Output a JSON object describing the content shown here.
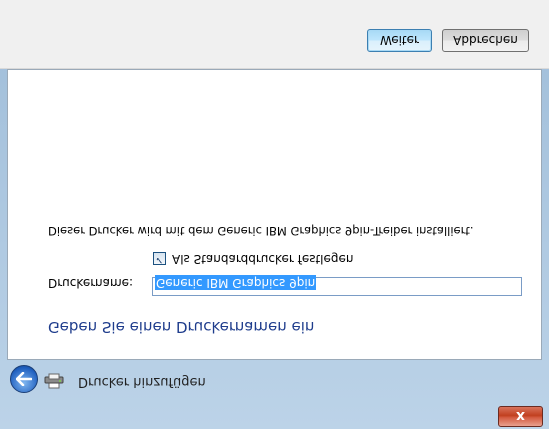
{
  "titlebar": {
    "close_label": "x"
  },
  "header": {
    "title": "Drucker hinzufügen"
  },
  "main": {
    "heading": "Geben Sie einen Druckernamen ein",
    "name_label": "Druckername:",
    "name_value": "Generic IBM Graphics 9pin",
    "default_checkbox_label": "Als Standarddrucker festlegen",
    "default_checked": true,
    "info": "Dieser Drucker wird mit dem Generic IBM Graphics 9pin-Treiber installiert."
  },
  "buttons": {
    "next": "Weiter",
    "cancel": "Abbrechen"
  },
  "icons": {
    "back": "back-arrow-icon",
    "printer": "printer-icon",
    "close": "close-icon"
  }
}
